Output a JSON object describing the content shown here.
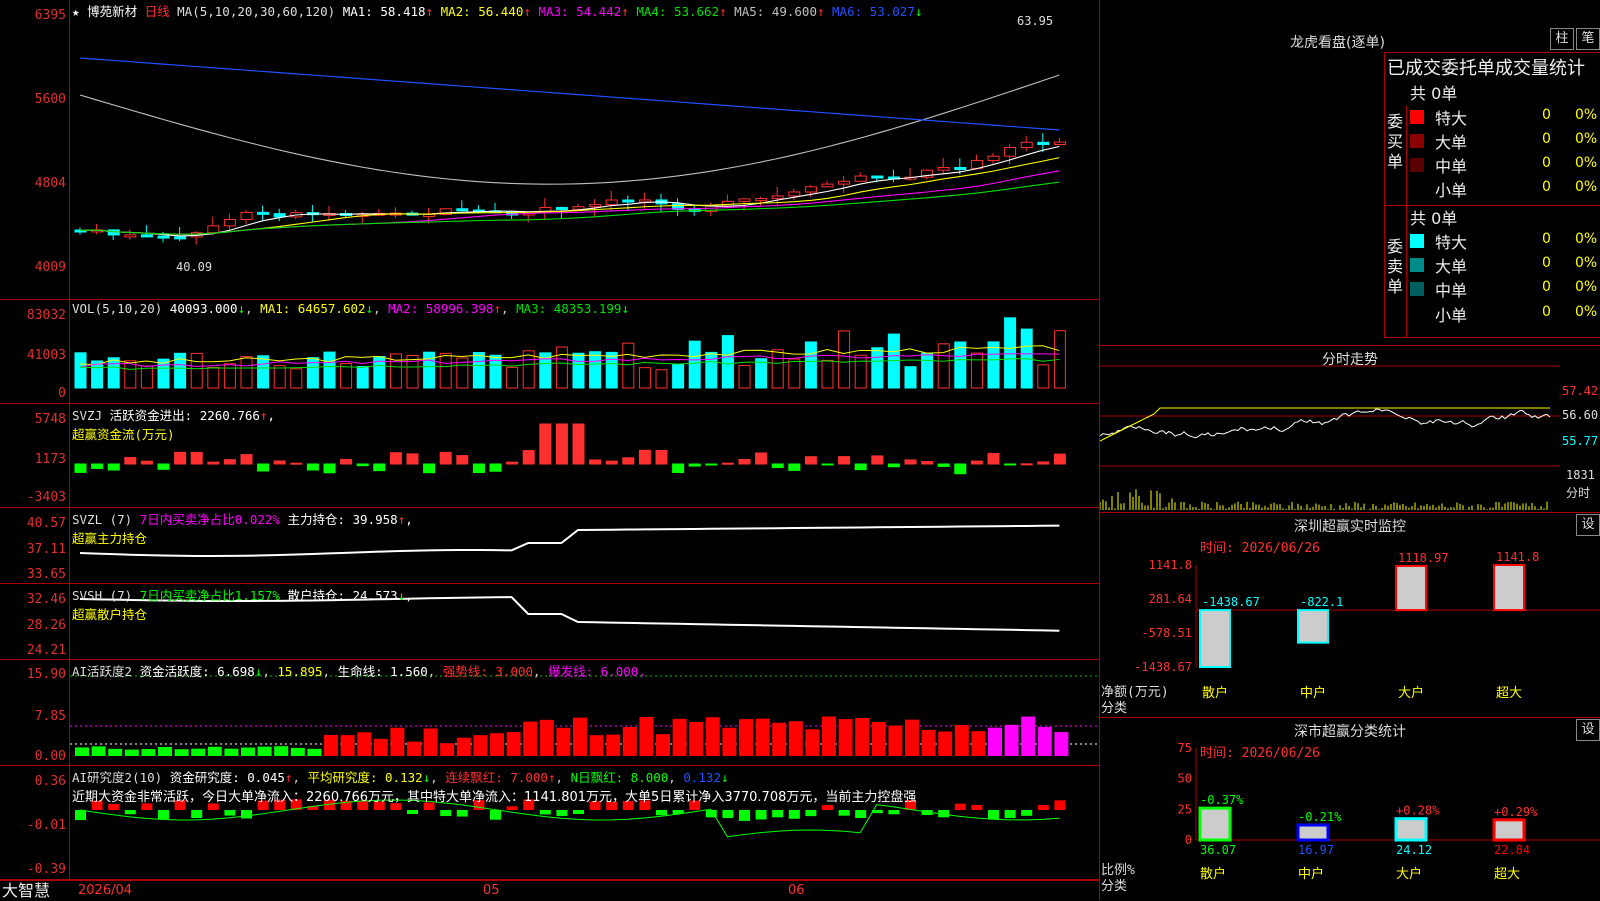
{
  "stock": {
    "star": "★",
    "name": "博苑新材",
    "period": "日线"
  },
  "kline": {
    "ma_label": "MA(5,10,20,30,60,120)",
    "ma": [
      {
        "label": "MA1:",
        "value": "58.418",
        "arrow": "↑",
        "color": "#ffffff"
      },
      {
        "label": "MA2:",
        "value": "56.440",
        "arrow": "↑",
        "color": "#ffff00"
      },
      {
        "label": "MA3:",
        "value": "54.442",
        "arrow": "↑",
        "color": "#ff00ff"
      },
      {
        "label": "MA4:",
        "value": "53.662",
        "arrow": "↑",
        "color": "#00e000"
      },
      {
        "label": "MA5:",
        "value": "49.600",
        "arrow": "↑",
        "color": "#c0c0c0"
      },
      {
        "label": "MA6:",
        "value": "53.027",
        "arrow": "↓",
        "color": "#2050ff"
      }
    ],
    "y_ticks": [
      "6395",
      "5600",
      "4804",
      "4009"
    ],
    "high_label": "63.95",
    "low_label": "40.09"
  },
  "vol": {
    "label": "VOL(5,10,20)",
    "value": "40093.000",
    "arrow": "↓",
    "ma1": "MA1: 64657.602",
    "ma1_arrow": "↓",
    "ma2": "MA2: 58996.398",
    "ma2_arrow": "↑",
    "ma3": "MA3: 48353.199",
    "ma3_arrow": "↓",
    "y_ticks": [
      "83032",
      "41003",
      "0"
    ]
  },
  "svzj": {
    "label": "SVZJ",
    "text": "活跃资金进出: 2260.766",
    "arrow": "↑",
    "comma": ",",
    "sub": "超赢资金流(万元)",
    "y_ticks": [
      "5748",
      "1173",
      "-3403"
    ]
  },
  "svzl": {
    "label": "SVZL (7)",
    "ratio": "7日内买卖净占比0.022%",
    "hold": "主力持仓: 39.958",
    "arrow": "↑",
    "comma": ",",
    "sub": "超赢主力持仓",
    "y_ticks": [
      "40.57",
      "37.11",
      "33.65"
    ]
  },
  "svsh": {
    "label": "SVSH (7)",
    "ratio": "7日内买卖净占比1.157%",
    "hold": "散户持仓: 24.573",
    "arrow": "↓",
    "comma": ",",
    "sub": "超赢散户持仓",
    "y_ticks": [
      "32.46",
      "28.26",
      "24.21"
    ]
  },
  "ai_active": {
    "label": "AI活跃度2",
    "a": "资金活跃度: 6.698",
    "a_arrow": "↓",
    "b": "15.895",
    "c": "生命线: 1.560",
    "d": "强势线: 3.000",
    "e": "爆发线: 6.000",
    "end": ",",
    "y_ticks": [
      "15.90",
      "7.85",
      "0.00"
    ]
  },
  "ai_research": {
    "label": "AI研究度2(10)",
    "a": "资金研究度: 0.045",
    "a_arrow": "↑",
    "b": "平均研究度: 0.132",
    "b_arrow": "↓",
    "c": "连续飘红: 7.000",
    "c_arrow": "↑",
    "d": "N日飘红: 8.000",
    "e": "0.132",
    "e_arrow": "↓",
    "comment": "近期大资金非常活跃，今日大单净流入：2260.766万元，其中特大单净流入：1141.801万元，大单5日累计净入3770.708万元，当前主力控盘强",
    "y_ticks": [
      "0.36",
      "-0.01",
      "-0.39"
    ]
  },
  "bottom_axis": {
    "brand": "大智慧",
    "date": "2026/04",
    "m5": "05",
    "m6": "06"
  },
  "longhu": {
    "title": "龙虎看盘(逐单)",
    "btn1": "柱",
    "btn2": "笔",
    "header": "已成交委托单成交量统计",
    "buy": {
      "title_chars": [
        "委",
        "买",
        "单"
      ],
      "total": "共 0单",
      "rows": [
        {
          "name": "特大",
          "color": "#ff0000",
          "v": "0",
          "p": "0%"
        },
        {
          "name": "大单",
          "color": "#8b0000",
          "v": "0",
          "p": "0%"
        },
        {
          "name": "中单",
          "color": "#5a0000",
          "v": "0",
          "p": "0%"
        },
        {
          "name": "小单",
          "color": "",
          "v": "0",
          "p": "0%"
        }
      ]
    },
    "sell": {
      "title_chars": [
        "委",
        "卖",
        "单"
      ],
      "total": "共 0单",
      "rows": [
        {
          "name": "特大",
          "color": "#00ffff",
          "v": "0",
          "p": "0%"
        },
        {
          "name": "大单",
          "color": "#008b8b",
          "v": "0",
          "p": "0%"
        },
        {
          "name": "中单",
          "color": "#006060",
          "v": "0",
          "p": "0%"
        },
        {
          "name": "小单",
          "color": "",
          "v": "0",
          "p": "0%"
        }
      ]
    }
  },
  "intraday": {
    "title": "分时走势",
    "y_ticks": [
      "57.42",
      "56.60",
      "55.77"
    ],
    "vol_tick": "1831",
    "vol_unit": "分时"
  },
  "sz_monitor": {
    "title": "深圳超赢实时监控",
    "btn": "设",
    "time": "时间: 2026/06/26",
    "y_ticks": [
      "1141.8",
      "281.64",
      "-578.51",
      "-1438.67"
    ],
    "yunit": "净额(万元)",
    "xunit": "分类",
    "bars": [
      {
        "cat": "散户",
        "value": -1438.67,
        "label": "-1438.67"
      },
      {
        "cat": "中户",
        "value": -822.1,
        "label": "-822.1"
      },
      {
        "cat": "大户",
        "value": 1118.97,
        "label": "1118.97"
      },
      {
        "cat": "超大",
        "value": 1141.8,
        "label": "1141.8"
      }
    ]
  },
  "sz_class": {
    "title": "深市超赢分类统计",
    "btn": "设",
    "time": "时间: 2026/06/26",
    "y_ticks": [
      "75",
      "50",
      "25",
      "0"
    ],
    "yunit": "比例%",
    "xunit": "分类",
    "bars": [
      {
        "cat": "散户",
        "value": 36.07,
        "change": "-0.37%"
      },
      {
        "cat": "中户",
        "value": 16.97,
        "change": "-0.21%"
      },
      {
        "cat": "大户",
        "value": 24.12,
        "change": "+0.28%"
      },
      {
        "cat": "超大",
        "value": 22.84,
        "change": "+0.29%"
      }
    ]
  }
}
